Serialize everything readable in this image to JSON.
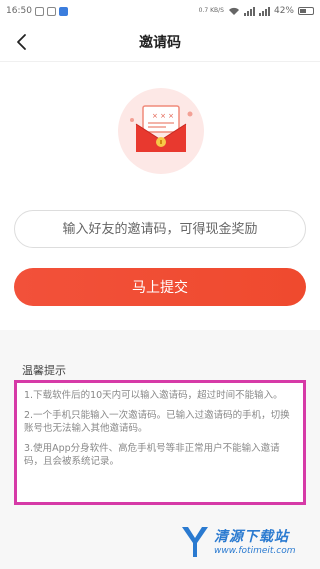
{
  "status_bar": {
    "time": "16:50",
    "network_speed": "0.7\nKB/S",
    "battery_percent": "42%"
  },
  "header": {
    "title": "邀请码"
  },
  "form": {
    "invite_placeholder": "输入好友的邀请码，可得现金奖励",
    "submit_label": "马上提交"
  },
  "tips": {
    "title": "温馨提示",
    "items": [
      "1.下载软件后的10天内可以输入邀请码，超过时间不能输入。",
      "2.一个手机只能输入一次邀请码。已输入过邀请码的手机，切换账号也无法输入其他邀请码。",
      "3.使用App分身软件、高危手机号等非正常用户不能输入邀请码，且会被系统记录。"
    ]
  },
  "watermark": {
    "name": "清源下载站",
    "url": "www.fotimeit.com"
  },
  "colors": {
    "accent": "#ef4a2e",
    "highlight_border": "#d63aa7",
    "watermark": "#2a7ad0"
  }
}
